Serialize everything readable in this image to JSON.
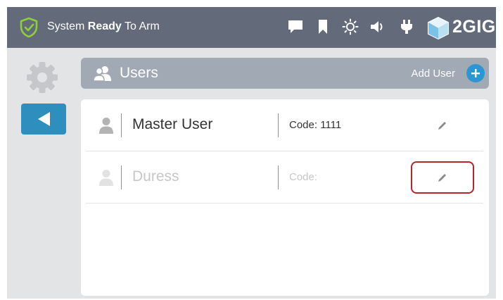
{
  "status": {
    "prefix": "System ",
    "emphasis": "Ready",
    "suffix": " To Arm",
    "shield_icon": "shield-check-icon"
  },
  "top_icons": [
    "message-icon",
    "bookmark-icon",
    "brightness-icon",
    "volume-icon",
    "power-plug-icon"
  ],
  "brand": {
    "name": "2GIG",
    "icon": "2gig-cube-logo"
  },
  "nav": {
    "settings_icon": "gear-icon",
    "back_icon": "back-arrow-icon"
  },
  "page": {
    "title": "Users",
    "title_icon": "users-icon",
    "add_label": "Add User",
    "add_icon": "plus-icon"
  },
  "users": [
    {
      "name": "Master User",
      "code": "Code: 1111",
      "enabled": true,
      "edit_icon": "pencil-icon",
      "highlighted": false
    },
    {
      "name": "Duress",
      "code": "Code:",
      "enabled": false,
      "edit_icon": "pencil-icon",
      "highlighted": true
    }
  ],
  "colors": {
    "topbar": "#636b7a",
    "accent_green": "#8ccf3a",
    "accent_blue": "#2e8fbe",
    "highlight_red": "#b3262d"
  }
}
